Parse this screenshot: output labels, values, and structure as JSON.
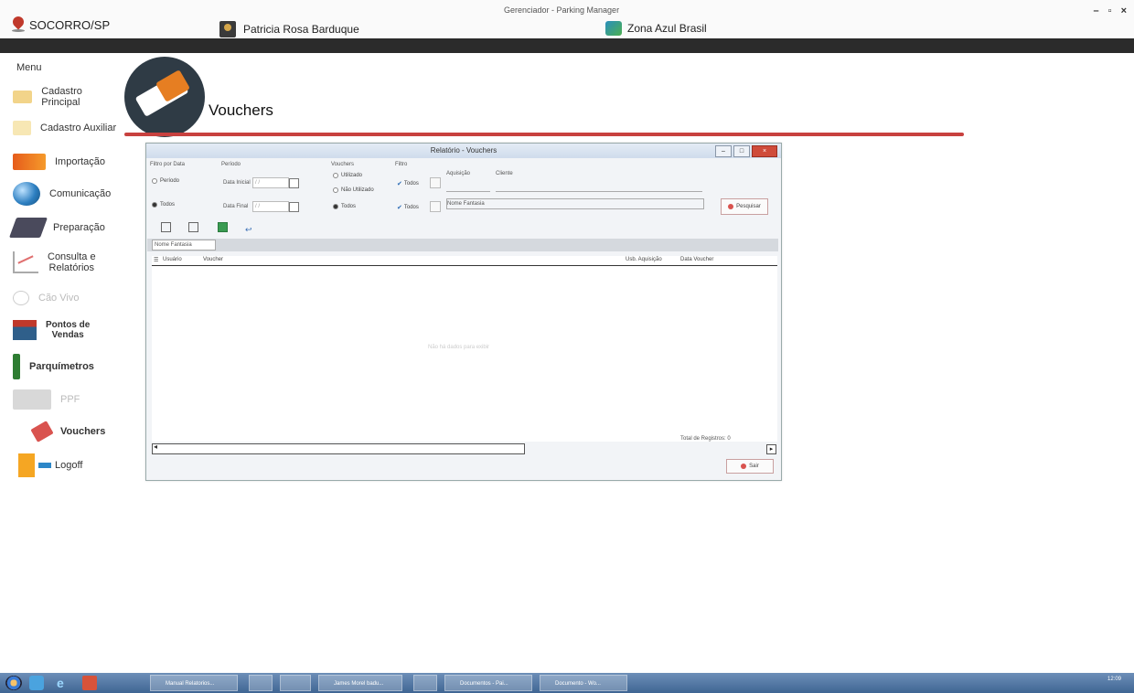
{
  "window": {
    "app_title": "Gerenciador - Parking Manager",
    "location": "SOCORRO/SP",
    "user_name": "Patricia Rosa Barduque",
    "company": "Zona Azul Brasil",
    "controls": [
      "–",
      "▫",
      "×"
    ],
    "status_left": "",
    "status_right": ""
  },
  "sidebar": {
    "menu_title": "Menu",
    "items": [
      {
        "label": "Cadastro Principal",
        "icon": "folder-icon"
      },
      {
        "label": "Cadastro Auxiliar",
        "icon": "folder-icon"
      },
      {
        "label": "Importação",
        "icon": "import-icon"
      },
      {
        "label": "Comunicação",
        "icon": "globe-icon"
      },
      {
        "label": "Preparação",
        "icon": "book-icon"
      },
      {
        "label": "Consulta e\nRelatórios",
        "icon": "chart-icon"
      },
      {
        "label": "Cão Vivo",
        "icon": "eye-icon"
      },
      {
        "label": "Pontos de\nVendas",
        "icon": "store-icon"
      },
      {
        "label": "Parquímetros",
        "icon": "parking-meter-icon"
      },
      {
        "label": "PPF",
        "icon": "ppf-icon"
      },
      {
        "label": "Vouchers",
        "icon": "ticket-icon"
      },
      {
        "label": "Logoff",
        "icon": "logoff-icon"
      }
    ]
  },
  "page": {
    "title": "Vouchers",
    "logo_text": "TICKET"
  },
  "dialog": {
    "title": "Relatório - Vouchers",
    "filter_date_label": "Filtro por Data",
    "period_label": "Período",
    "radio_periodo": "Período",
    "radio_todos": "Todos",
    "data_inicial_label": "Data Inicial",
    "data_final_label": "Data Final",
    "data_inicial_value": "/ /",
    "data_final_value": "/ /",
    "voucher_label": "Vouchers",
    "radio_utilizado": "Utilizado",
    "radio_nao_utilizado": "Não Utilizado",
    "radio_todos2": "Todos",
    "filtro_label": "Filtro",
    "chk_todos1": "Todos",
    "chk_todos2": "Todos",
    "aquisicao_label": "Aquisição",
    "cliente_label": "Cliente",
    "nome_fantasia_field": "Nome Fantasia",
    "pesquisar_button": "Pesquisar",
    "grid_search_placeholder": "Nome Fantasia",
    "columns": [
      "Usuário",
      "Voucher",
      "Usb. Aquisição",
      "Data Voucher"
    ],
    "empty_message": "Não há dados para exibir",
    "total_label": "Total de Registros: 0",
    "sair_button": "Sair"
  },
  "taskbar": {
    "tasks": [
      "Manual Relatorios...",
      "",
      "",
      "James Morel badu...",
      "",
      "Documentos - Pai...",
      "Documento - Wo..."
    ],
    "clock": "12:09"
  }
}
